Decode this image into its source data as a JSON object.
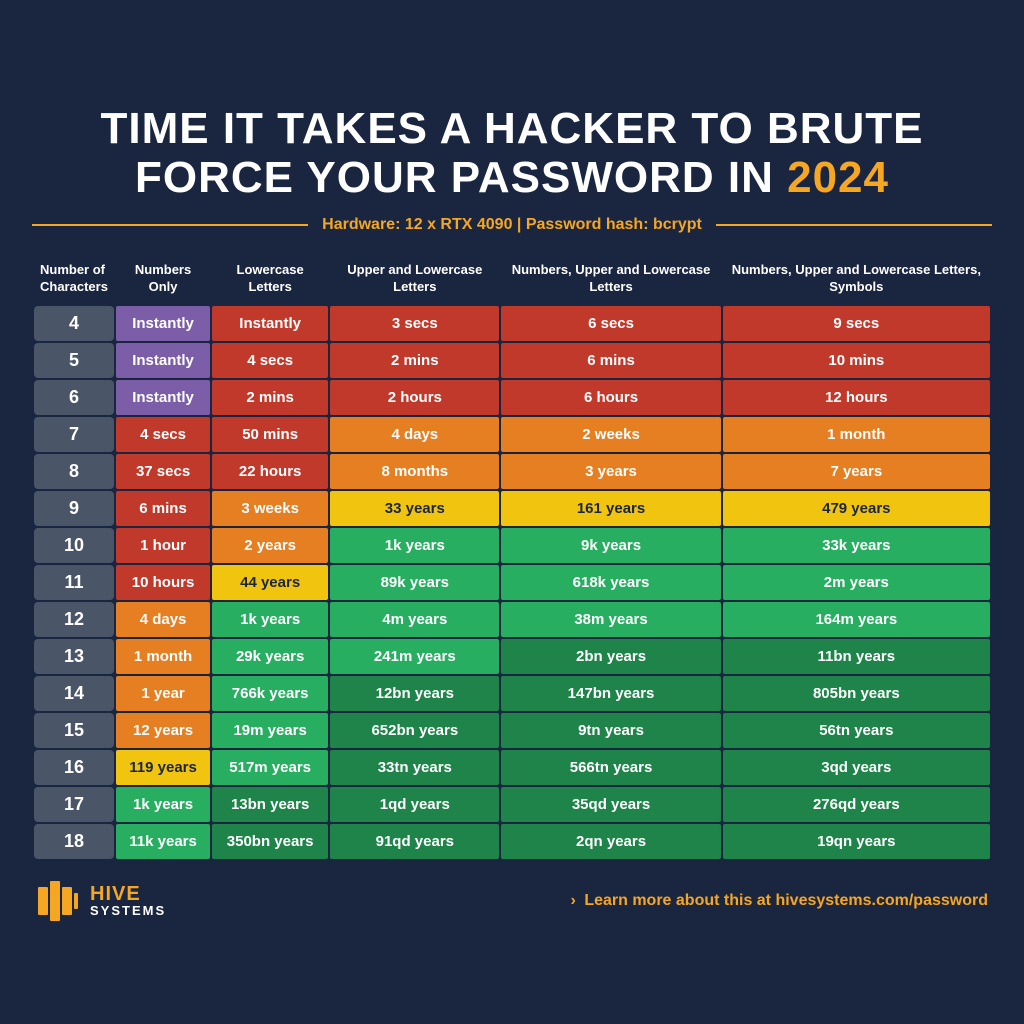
{
  "title": {
    "line1": "TIME IT TAKES A HACKER TO BRUTE",
    "line2": "FORCE YOUR PASSWORD IN ",
    "year": "2024"
  },
  "subtitle": "Hardware: 12 x RTX 4090  |  Password hash: bcrypt",
  "columns": [
    "Number of Characters",
    "Numbers Only",
    "Lowercase Letters",
    "Upper and Lowercase Letters",
    "Numbers, Upper and Lowercase Letters",
    "Numbers, Upper and Lowercase Letters, Symbols"
  ],
  "rows": [
    {
      "chars": "4",
      "c1": "Instantly",
      "c2": "Instantly",
      "c3": "3 secs",
      "c4": "6 secs",
      "c5": "9 secs"
    },
    {
      "chars": "5",
      "c1": "Instantly",
      "c2": "4 secs",
      "c3": "2 mins",
      "c4": "6 mins",
      "c5": "10 mins"
    },
    {
      "chars": "6",
      "c1": "Instantly",
      "c2": "2 mins",
      "c3": "2 hours",
      "c4": "6 hours",
      "c5": "12 hours"
    },
    {
      "chars": "7",
      "c1": "4 secs",
      "c2": "50 mins",
      "c3": "4 days",
      "c4": "2 weeks",
      "c5": "1 month"
    },
    {
      "chars": "8",
      "c1": "37 secs",
      "c2": "22 hours",
      "c3": "8 months",
      "c4": "3 years",
      "c5": "7 years"
    },
    {
      "chars": "9",
      "c1": "6 mins",
      "c2": "3 weeks",
      "c3": "33 years",
      "c4": "161 years",
      "c5": "479 years"
    },
    {
      "chars": "10",
      "c1": "1 hour",
      "c2": "2 years",
      "c3": "1k years",
      "c4": "9k years",
      "c5": "33k years"
    },
    {
      "chars": "11",
      "c1": "10 hours",
      "c2": "44 years",
      "c3": "89k years",
      "c4": "618k years",
      "c5": "2m years"
    },
    {
      "chars": "12",
      "c1": "4 days",
      "c2": "1k years",
      "c3": "4m years",
      "c4": "38m years",
      "c5": "164m years"
    },
    {
      "chars": "13",
      "c1": "1 month",
      "c2": "29k years",
      "c3": "241m years",
      "c4": "2bn years",
      "c5": "11bn years"
    },
    {
      "chars": "14",
      "c1": "1 year",
      "c2": "766k years",
      "c3": "12bn years",
      "c4": "147bn years",
      "c5": "805bn years"
    },
    {
      "chars": "15",
      "c1": "12 years",
      "c2": "19m years",
      "c3": "652bn years",
      "c4": "9tn years",
      "c5": "56tn years"
    },
    {
      "chars": "16",
      "c1": "119 years",
      "c2": "517m years",
      "c3": "33tn years",
      "c4": "566tn years",
      "c5": "3qd years"
    },
    {
      "chars": "17",
      "c1": "1k years",
      "c2": "13bn years",
      "c3": "1qd years",
      "c4": "35qd years",
      "c5": "276qd years"
    },
    {
      "chars": "18",
      "c1": "11k years",
      "c2": "350bn years",
      "c3": "91qd years",
      "c4": "2qn years",
      "c5": "19qn years"
    }
  ],
  "footer": {
    "brand": "HIVE",
    "brand_sub": "SYSTEMS",
    "link_text": "Learn more about this at ",
    "link_url": "hivesystems.com/password",
    "arrow": "›"
  }
}
